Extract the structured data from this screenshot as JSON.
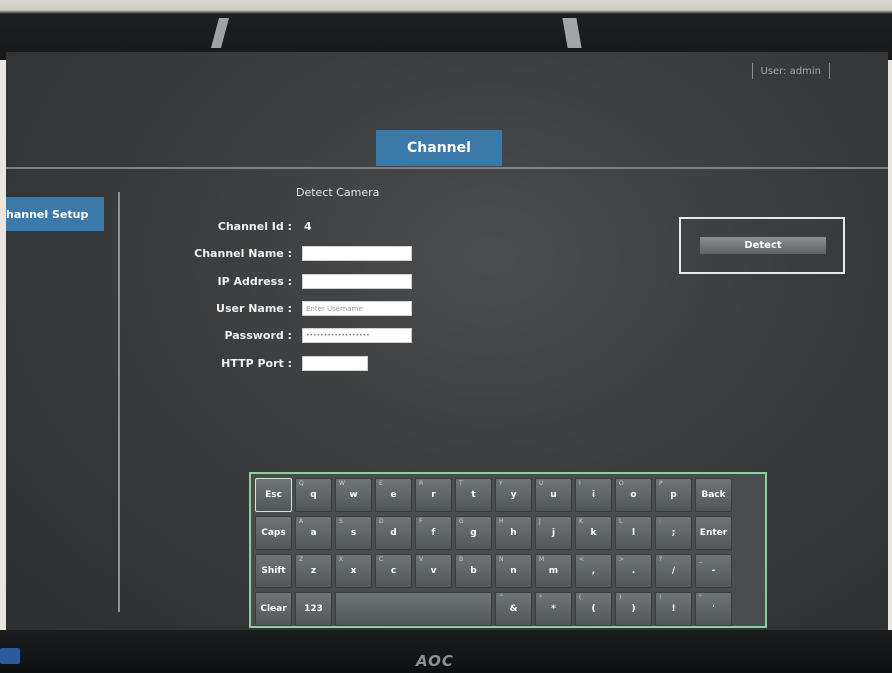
{
  "monitor": {
    "brand": "AOC"
  },
  "status_bar": {
    "user_label": "User: admin"
  },
  "page": {
    "title_tab": "Channel"
  },
  "sidebar": {
    "items": [
      {
        "label": "hannel Setup"
      }
    ]
  },
  "form": {
    "section_title": "Detect Camera",
    "fields": {
      "channel_id": {
        "label": "Channel Id :",
        "value": "4"
      },
      "channel_name": {
        "label": "Channel Name :",
        "value": ""
      },
      "ip_address": {
        "label": "IP Address :",
        "value": ""
      },
      "user_name": {
        "label": "User Name :",
        "placeholder": "Enter Username"
      },
      "password": {
        "label": "Password :",
        "value": "••••••••••••••••••"
      },
      "http_port": {
        "label": "HTTP Port :",
        "value": ""
      }
    },
    "detect_button": "Detect"
  },
  "keyboard": {
    "rows": [
      [
        {
          "label": "Esc",
          "alt": ""
        },
        {
          "label": "q",
          "alt": "Q"
        },
        {
          "label": "w",
          "alt": "W"
        },
        {
          "label": "e",
          "alt": "E"
        },
        {
          "label": "r",
          "alt": "R"
        },
        {
          "label": "t",
          "alt": "T"
        },
        {
          "label": "y",
          "alt": "Y"
        },
        {
          "label": "u",
          "alt": "U"
        },
        {
          "label": "i",
          "alt": "I"
        },
        {
          "label": "o",
          "alt": "O"
        },
        {
          "label": "p",
          "alt": "P"
        },
        {
          "label": "Back",
          "alt": ""
        }
      ],
      [
        {
          "label": "Caps",
          "alt": ""
        },
        {
          "label": "a",
          "alt": "A"
        },
        {
          "label": "s",
          "alt": "S"
        },
        {
          "label": "d",
          "alt": "D"
        },
        {
          "label": "f",
          "alt": "F"
        },
        {
          "label": "g",
          "alt": "G"
        },
        {
          "label": "h",
          "alt": "H"
        },
        {
          "label": "j",
          "alt": "J"
        },
        {
          "label": "k",
          "alt": "K"
        },
        {
          "label": "l",
          "alt": "L"
        },
        {
          "label": ";",
          "alt": ":"
        },
        {
          "label": "Enter",
          "alt": ""
        }
      ],
      [
        {
          "label": "Shift",
          "alt": ""
        },
        {
          "label": "z",
          "alt": "Z"
        },
        {
          "label": "x",
          "alt": "X"
        },
        {
          "label": "c",
          "alt": "C"
        },
        {
          "label": "v",
          "alt": "V"
        },
        {
          "label": "b",
          "alt": "B"
        },
        {
          "label": "n",
          "alt": "N"
        },
        {
          "label": "m",
          "alt": "M"
        },
        {
          "label": ",",
          "alt": "<"
        },
        {
          "label": ".",
          "alt": ">"
        },
        {
          "label": "/",
          "alt": "?"
        },
        {
          "label": "-",
          "alt": "_"
        }
      ],
      [
        {
          "label": "Clear",
          "alt": ""
        },
        {
          "label": "123",
          "alt": ""
        },
        {
          "label": "",
          "alt": ""
        },
        {
          "label": "&",
          "alt": "^"
        },
        {
          "label": "*",
          "alt": "*"
        },
        {
          "label": "(",
          "alt": "("
        },
        {
          "label": ")",
          "alt": ")"
        },
        {
          "label": "!",
          "alt": "!"
        },
        {
          "label": "'",
          "alt": "\""
        }
      ]
    ]
  }
}
